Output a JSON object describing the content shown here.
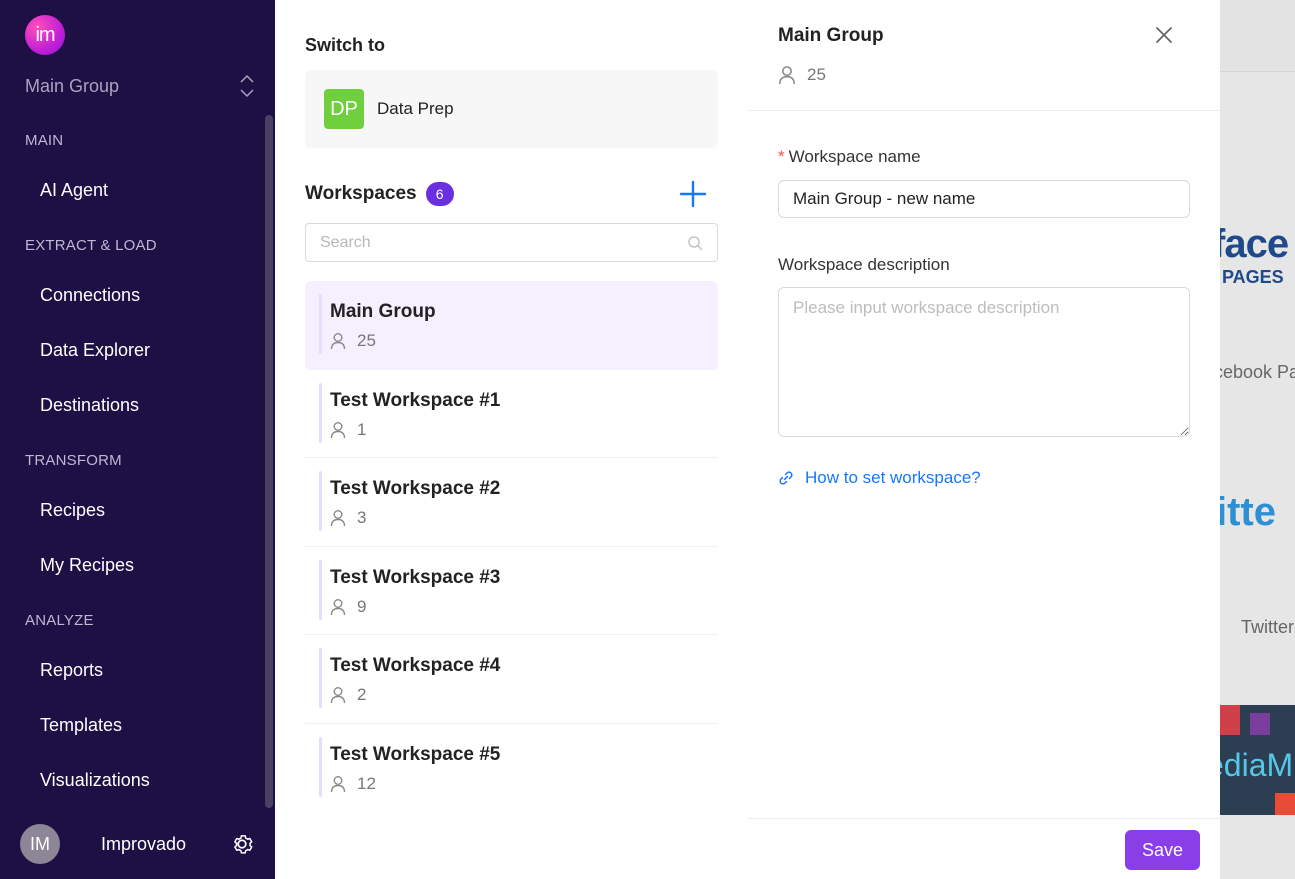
{
  "sidebar": {
    "logo_text": "im",
    "group_name": "Main Group",
    "sections": {
      "main": "MAIN",
      "extract_load": "EXTRACT & LOAD",
      "transform": "TRANSFORM",
      "analyze": "ANALYZE"
    },
    "items": {
      "ai_agent": "AI Agent",
      "connections": "Connections",
      "data_explorer": "Data Explorer",
      "destinations": "Destinations",
      "recipes": "Recipes",
      "my_recipes": "My Recipes",
      "reports": "Reports",
      "templates": "Templates",
      "visualizations": "Visualizations"
    },
    "user": {
      "initials": "IM",
      "name": "Improvado"
    },
    "colors": {
      "background": "#1e0f45"
    }
  },
  "switcher": {
    "title": "Switch to",
    "target": {
      "initials": "DP",
      "name": "Data Prep",
      "color": "#6fcf3c"
    },
    "workspaces_title": "Workspaces",
    "workspaces_count": "6",
    "search_placeholder": "Search",
    "workspaces": [
      {
        "name": "Main Group",
        "members": "25",
        "active": true
      },
      {
        "name": "Test Workspace #1",
        "members": "1"
      },
      {
        "name": "Test Workspace #2",
        "members": "3"
      },
      {
        "name": "Test Workspace #3",
        "members": "9"
      },
      {
        "name": "Test Workspace #4",
        "members": "2"
      },
      {
        "name": "Test Workspace #5",
        "members": "12"
      }
    ]
  },
  "editor": {
    "title": "Main Group",
    "members": "25",
    "name_label": "Workspace name",
    "required_mark": "*",
    "name_value": "Main Group - new name",
    "description_label": "Workspace description",
    "description_placeholder": "Please input workspace description",
    "help_link": "How to set workspace?",
    "save_label": "Save",
    "colors": {
      "accent": "#8a3ee8",
      "link": "#1677ff"
    }
  },
  "background_page": {
    "face_text": "face",
    "pages_text": "PAGES",
    "caption_1": "acebook Pa",
    "twitter_text": "itte",
    "caption_2": "Twitter",
    "media_text": "ediaM"
  }
}
